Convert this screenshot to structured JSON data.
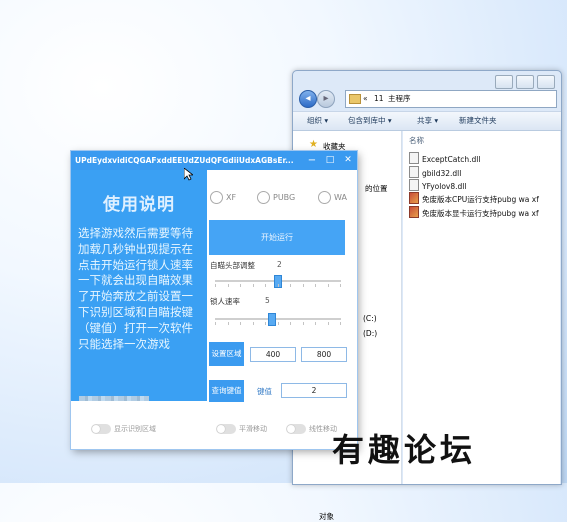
{
  "explorer": {
    "address_parts": [
      "«",
      "11",
      "主程序"
    ],
    "toolbar": [
      "组织 ▾",
      "包含到库中 ▾",
      "共享 ▾",
      "新建文件夹"
    ],
    "nav_items": [
      "收藏夹",
      "的位置",
      "(C:)",
      "(D:)",
      "对象"
    ],
    "column_header": "名称",
    "files": [
      {
        "name": "ExceptCatch.dll",
        "icon": "dll-file-icon"
      },
      {
        "name": "gbild32.dll",
        "icon": "dll-file-icon"
      },
      {
        "name": "YFyolov8.dll",
        "icon": "dll-file-icon"
      },
      {
        "name": "免废版本CPU运行支持pubg wa xf",
        "icon": "package-file-icon"
      },
      {
        "name": "免废版本显卡运行支持pubg wa xf",
        "icon": "package-file-icon"
      }
    ]
  },
  "app": {
    "title": "UPdEydxvidiCQGAFxddEEUdZUdQFGdiiUdxAGBsEr...",
    "window_buttons": [
      "−",
      "□",
      "✕"
    ],
    "usage_title": "使用说明",
    "usage_text": "选择游戏然后需要等待加载几秒钟出现提示在点击开始运行锁人速率一下就会出现自瞄效果了开始奔放之前设置一下识别区域和自瞄按键（键值）打开一次软件只能选择一次游戏",
    "games": [
      "XF",
      "PUBG",
      "WA"
    ],
    "start_button": "开始运行",
    "slider1": {
      "label": "自瞄头部调整",
      "value": "2",
      "level": 0.5
    },
    "slider2": {
      "label": "锁人速率",
      "value": "5",
      "level": 0.45
    },
    "region_button": "设置区域",
    "region_width": "400",
    "region_height": "800",
    "hotkey_button": "查询键值",
    "key_label": "键值",
    "key_value": "2",
    "toggles": [
      "显示识别区域",
      "平滑移动",
      "线性移动"
    ]
  },
  "watermark": "有趣论坛",
  "colors": {
    "accent": "#3a9af0",
    "panel": "#3aa0f3",
    "window_bg": "#ffffff"
  }
}
